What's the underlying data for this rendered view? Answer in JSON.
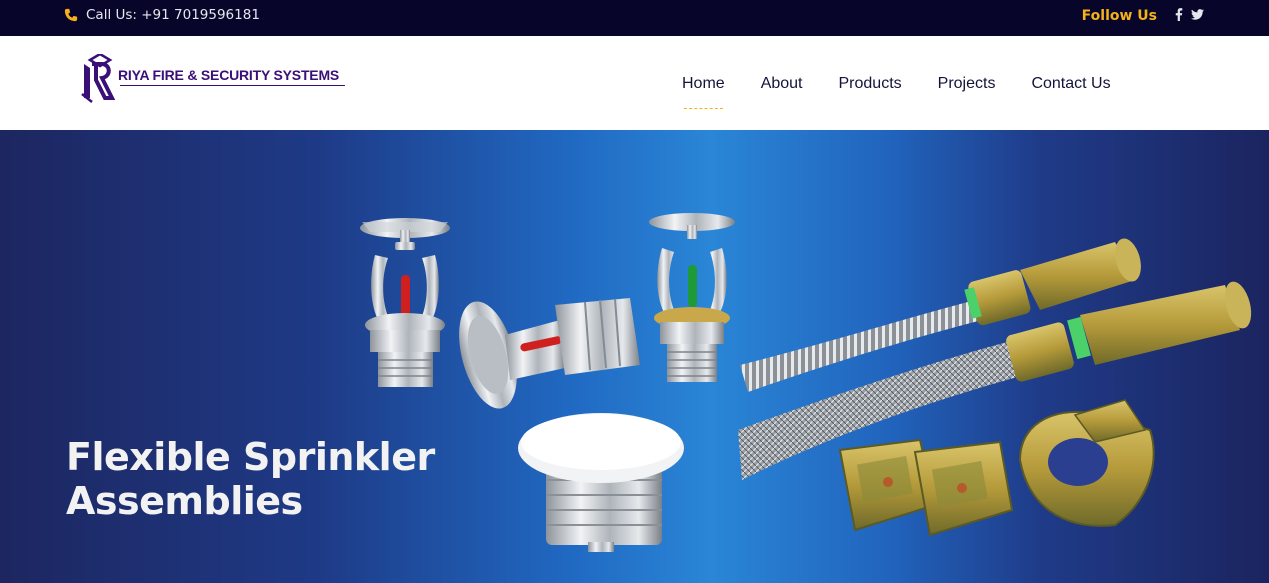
{
  "topbar": {
    "call_text": "Call Us: +91 7019596181",
    "follow_label": "Follow Us",
    "social": [
      {
        "icon": "facebook-icon",
        "glyph": "f"
      },
      {
        "icon": "twitter-icon",
        "glyph": "🐦"
      }
    ]
  },
  "logo": {
    "text": "RIYA FIRE & SECURITY SYSTEMS"
  },
  "nav": {
    "items": [
      {
        "label": "Home",
        "active": true
      },
      {
        "label": "About"
      },
      {
        "label": "Products"
      },
      {
        "label": "Projects"
      },
      {
        "label": "Contact Us"
      }
    ]
  },
  "hero": {
    "title_line1": "Flexible Sprinkler",
    "title_line2": "Assemblies"
  },
  "colors": {
    "topbar_bg": "#07062a",
    "accent": "#f5b01a",
    "brand": "#3a0f78",
    "nav_text": "#14143a"
  }
}
